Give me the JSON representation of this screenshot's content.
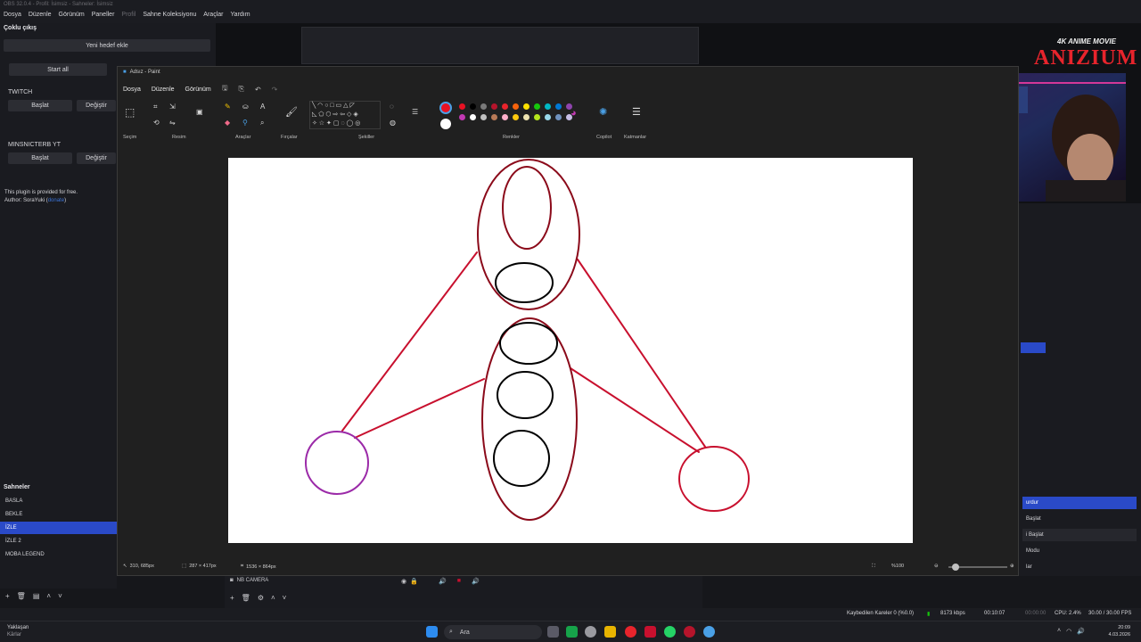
{
  "obs": {
    "window_title": "OBS 32.0.4 - Profil: İsimsiz - Sahneler: İsimsiz",
    "menu": [
      "Dosya",
      "Düzenle",
      "Görünüm",
      "Paneller",
      "Profil",
      "Sahne Koleksiyonu",
      "Araçlar",
      "Yardım"
    ],
    "multi_output": {
      "title": "Çoklu çıkış",
      "add_target": "Yeni hedef ekle",
      "start_all": "Start all",
      "targets": [
        {
          "name": "TWITCH",
          "start": "Başlat",
          "edit": "Değiştir"
        },
        {
          "name": "MINSNICTERB YT",
          "start": "Başlat",
          "edit": "Değiştir"
        }
      ],
      "plugin_line1": "This plugin is provided for free.",
      "plugin_line2_prefix": "Author: SoraYuki (",
      "plugin_link": "donate",
      "plugin_line2_suffix": ")"
    },
    "scenes": {
      "title": "Sahneler",
      "items": [
        "BASLA",
        "BEKLE",
        "İZLE",
        "İZLE 2",
        "MOBA LEGEND"
      ],
      "active_index": 2
    },
    "sources": {
      "camera": "NB CAMERA"
    },
    "controls": [
      "urdur",
      "Başlat",
      "i Başlat",
      "Modu",
      "lar"
    ],
    "stats": {
      "dropped": "Kaybedilen Kareler 0 (%0.0)",
      "bitrate": "8173 kbps",
      "rec_time": "00:10:07",
      "stream_time": "00:00:00",
      "cpu": "CPU: 2.4%",
      "fps": "30.00 / 30.00 FPS"
    },
    "brand": {
      "name": "ANIZIUM",
      "tagline": "4K ANIME MOVIE"
    }
  },
  "paint": {
    "title": "Adsız - Paint",
    "menu": [
      "Dosya",
      "Düzenle",
      "Görünüm"
    ],
    "groups": [
      "Seçim",
      "Resim",
      "Araçlar",
      "Fırçalar",
      "Şekiller",
      "Renkler",
      "Copilot",
      "Katmanlar"
    ],
    "status": {
      "cursor": "310, 685px",
      "selection": "287 × 417px",
      "canvas_size": "1536 × 864px",
      "zoom": "%100"
    },
    "palette": [
      "#e81123",
      "#000000",
      "#7a7a7a",
      "#b5142b",
      "#e8242c",
      "#f7630c",
      "#fce100",
      "#16c60c",
      "#00b7c3",
      "#0078d4",
      "#8e44ad",
      "#c239b3",
      "#ffffff",
      "#c0c0c0",
      "#b97a57",
      "#ffaec9",
      "#ffc90e",
      "#efe4b0",
      "#b5e61d",
      "#99d9ea",
      "#7092be",
      "#c8bfe7"
    ],
    "drawing": {
      "line_color": "#c8102e",
      "outline_color": "#000000",
      "dark_red": "#8b0a1a",
      "purple": "#9b2aa8"
    }
  },
  "taskbar": {
    "weather_title": "Yaklaşan",
    "weather_sub": "Kârlar",
    "search": "Ara",
    "time": "20:09",
    "date": "4.03.2026"
  }
}
